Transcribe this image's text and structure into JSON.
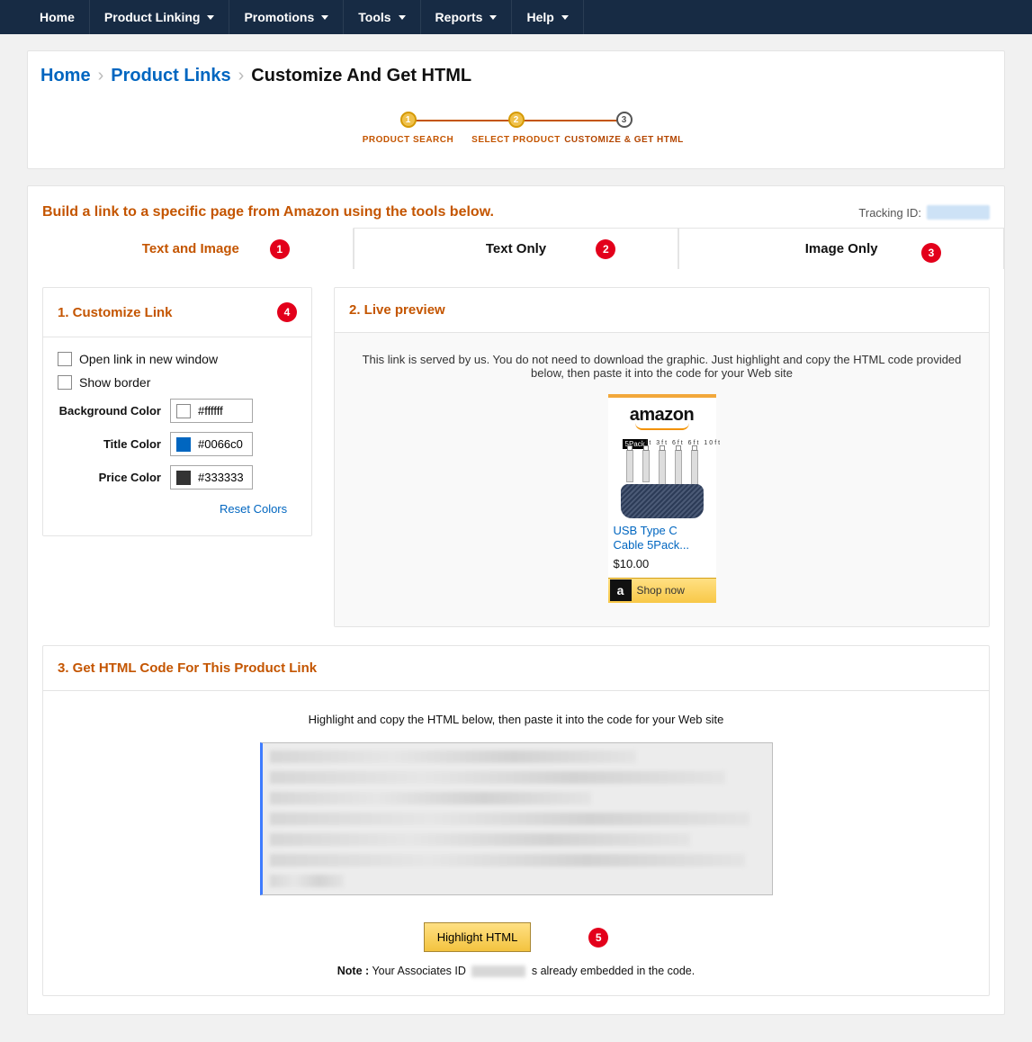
{
  "nav": [
    "Home",
    "Product Linking",
    "Promotions",
    "Tools",
    "Reports",
    "Help"
  ],
  "nav_has_caret": [
    false,
    true,
    true,
    true,
    true,
    true
  ],
  "breadcrumbs": {
    "home": "Home",
    "links": "Product Links",
    "current": "Customize And Get HTML"
  },
  "stepper": {
    "s1": "PRODUCT SEARCH",
    "s2": "SELECT PRODUCT",
    "s3": "CUSTOMIZE & GET HTML"
  },
  "build_title": "Build a link to a specific page from Amazon using the tools below.",
  "tracking_label": "Tracking ID:",
  "tabs": {
    "t1": "Text and Image",
    "t2": "Text Only",
    "t3": "Image Only"
  },
  "dots": {
    "d1": "1",
    "d2": "2",
    "d3": "3",
    "d4": "4",
    "d5": "5"
  },
  "customize": {
    "title": "1. Customize Link",
    "open_new": "Open link in new window",
    "show_border": "Show border",
    "bg_label": "Background Color",
    "bg_val": "#ffffff",
    "title_label": "Title Color",
    "title_val": "#0066c0",
    "price_label": "Price Color",
    "price_val": "#333333",
    "reset": "Reset Colors"
  },
  "preview": {
    "title": "2. Live preview",
    "desc": "This link is served by us. You do not need to download the graphic. Just highlight and copy the HTML code provided below, then paste it into the code for your Web site",
    "brand": "amazon",
    "pack": "5Pack",
    "spec": "3ft  3ft  6ft  6ft  10ft",
    "product_title": "USB Type C Cable 5Pack...",
    "price": "$10.00",
    "shop": "Shop now",
    "a": "a"
  },
  "section3": {
    "title": "3. Get HTML Code For This Product Link",
    "hint": "Highlight and copy the HTML below, then paste it into the code for your Web site",
    "button": "Highlight HTML",
    "note_bold": "Note :",
    "note_rest1": " Your Associates ID ",
    "note_rest2": "s already embedded in the code."
  }
}
